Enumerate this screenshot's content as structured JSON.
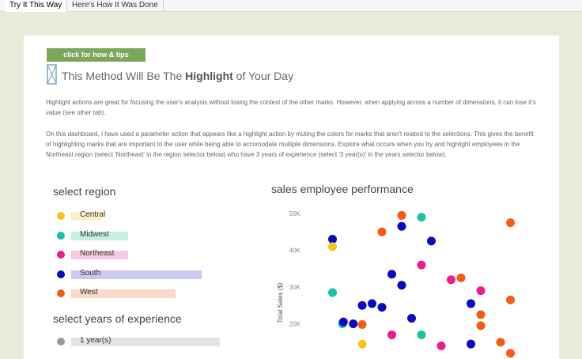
{
  "tabs": [
    "Try It This Way",
    "Here's How It Was Done"
  ],
  "tip_button": "click for how & tips",
  "title": {
    "prefix": "This Method Will Be The ",
    "highlight": "Highlight",
    "suffix": " of Your Day"
  },
  "paragraphs": [
    "Highlight actions are great for focusing the user's analysis without losing the context of the other marks. However, when applying across a number of dimensions, it can lose it's value (see other tab).",
    "On this dashboard, I have used a parameter action that appears like a highlight action by muting the colors for marks that aren't related to the selections. This gives the benefit of highlighting marks that are important to the user while being able to accomodate multiple dimensions. Explore what occurs when you try and highlight employees in the Northeast region (select 'Northeast' in the region selector below) who have 3 years of experience (select '3 year(s)' in the years selector below)."
  ],
  "region_selector": {
    "title": "select region",
    "items": [
      {
        "label": "Central",
        "color": "#f5c518",
        "bar_color": "#fdf0c4",
        "share": 0.15
      },
      {
        "label": "Midwest",
        "color": "#19c4a4",
        "bar_color": "#c6f0e6",
        "share": 0.28
      },
      {
        "label": "Northeast",
        "color": "#ee1b8b",
        "bar_color": "#f9c9e3",
        "share": 0.28
      },
      {
        "label": "South",
        "color": "#0a0ac0",
        "bar_color": "#cacaf1",
        "share": 0.64
      },
      {
        "label": "West",
        "color": "#f45b14",
        "bar_color": "#fcd8c6",
        "share": 0.51
      }
    ]
  },
  "years_selector": {
    "title": "select years of experience",
    "items": [
      {
        "label": "1 year(s)",
        "color": "#999999",
        "bar_color": "#e3e3e3",
        "share": 0.73
      }
    ]
  },
  "chart_data": {
    "type": "scatter",
    "title": "sales employee performance",
    "ylabel": "Total Sales ($)",
    "yticks": [
      "50K",
      "40K",
      "30K",
      "20K"
    ],
    "ylim": [
      0,
      52000
    ],
    "xlim": [
      0,
      20
    ],
    "points": [
      {
        "region": "South",
        "x": 1.0,
        "y": 43000
      },
      {
        "region": "Central",
        "x": 1.0,
        "y": 41000
      },
      {
        "region": "Midwest",
        "x": 1.0,
        "y": 28500
      },
      {
        "region": "Midwest",
        "x": 2.0,
        "y": 20000
      },
      {
        "region": "South",
        "x": 2.1,
        "y": 20500
      },
      {
        "region": "South",
        "x": 3.1,
        "y": 20000
      },
      {
        "region": "West",
        "x": 4.0,
        "y": 19800
      },
      {
        "region": "Central",
        "x": 4.0,
        "y": 14500
      },
      {
        "region": "South",
        "x": 4.0,
        "y": 25000
      },
      {
        "region": "South",
        "x": 5.0,
        "y": 25500
      },
      {
        "region": "South",
        "x": 6.0,
        "y": 24500
      },
      {
        "region": "West",
        "x": 6.0,
        "y": 45000
      },
      {
        "region": "South",
        "x": 7.0,
        "y": 33500
      },
      {
        "region": "Northeast",
        "x": 7.0,
        "y": 17000
      },
      {
        "region": "West",
        "x": 8.0,
        "y": 49500
      },
      {
        "region": "South",
        "x": 8.0,
        "y": 46500
      },
      {
        "region": "South",
        "x": 8.0,
        "y": 30500
      },
      {
        "region": "South",
        "x": 9.0,
        "y": 21500
      },
      {
        "region": "Midwest",
        "x": 10.0,
        "y": 49000
      },
      {
        "region": "Northeast",
        "x": 10.0,
        "y": 36000
      },
      {
        "region": "Midwest",
        "x": 10.0,
        "y": 17000
      },
      {
        "region": "South",
        "x": 11.0,
        "y": 42500
      },
      {
        "region": "Northeast",
        "x": 12.0,
        "y": 14000
      },
      {
        "region": "Northeast",
        "x": 13.0,
        "y": 32000
      },
      {
        "region": "West",
        "x": 14.0,
        "y": 32500
      },
      {
        "region": "South",
        "x": 15.0,
        "y": 25500
      },
      {
        "region": "South",
        "x": 15.0,
        "y": 14500
      },
      {
        "region": "Northeast",
        "x": 16.0,
        "y": 29000
      },
      {
        "region": "West",
        "x": 16.0,
        "y": 22500
      },
      {
        "region": "West",
        "x": 16.0,
        "y": 19500
      },
      {
        "region": "West",
        "x": 18.0,
        "y": 15000
      },
      {
        "region": "West",
        "x": 19.0,
        "y": 47500
      },
      {
        "region": "West",
        "x": 19.0,
        "y": 26500
      },
      {
        "region": "West",
        "x": 19.0,
        "y": 12000
      }
    ]
  }
}
